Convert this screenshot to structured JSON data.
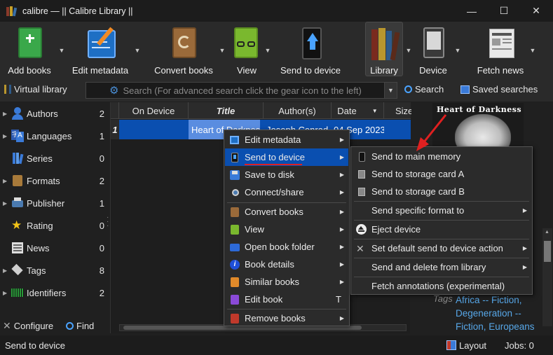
{
  "window": {
    "title": "calibre — || Calibre Library ||",
    "minimize": "—",
    "maximize": "☐",
    "close": "✕"
  },
  "toolbar": {
    "items": [
      {
        "label": "Add books",
        "icon": "add-books-icon"
      },
      {
        "label": "Edit metadata",
        "icon": "edit-metadata-icon"
      },
      {
        "label": "Convert books",
        "icon": "convert-books-icon"
      },
      {
        "label": "View",
        "icon": "view-icon"
      },
      {
        "label": "Send to device",
        "icon": "send-to-device-icon"
      },
      {
        "label": "Library",
        "icon": "library-icon"
      },
      {
        "label": "Device",
        "icon": "device-icon"
      },
      {
        "label": "Fetch news",
        "icon": "fetch-news-icon"
      }
    ]
  },
  "searchbar": {
    "virtual_library": "Virtual library",
    "placeholder": "Search (For advanced search click the gear icon to the left)",
    "search_label": "Search",
    "saved_searches_label": "Saved searches"
  },
  "tag_browser": {
    "items": [
      {
        "label": "Authors",
        "count": "2"
      },
      {
        "label": "Languages",
        "count": "1"
      },
      {
        "label": "Series",
        "count": "0"
      },
      {
        "label": "Formats",
        "count": "2"
      },
      {
        "label": "Publisher",
        "count": "1"
      },
      {
        "label": "Rating",
        "count": "0"
      },
      {
        "label": "News",
        "count": "0"
      },
      {
        "label": "Tags",
        "count": "8"
      },
      {
        "label": "Identifiers",
        "count": "2"
      }
    ],
    "configure_label": "Configure",
    "find_label": "Find"
  },
  "book_list": {
    "columns": [
      "On Device",
      "Title",
      "Author(s)",
      "Date",
      "Size"
    ],
    "rows": [
      {
        "num": "1",
        "on_device": "",
        "title": "Heart of Darkness",
        "authors": "Joseph Conrad",
        "date": "04 Sep 2023",
        "size": "0"
      }
    ]
  },
  "details": {
    "cover_title": "Heart of Darkness",
    "tags_label": "Tags",
    "tags_value": "Africa -- Fiction, Degeneration -- Fiction, Europeans"
  },
  "context_menu": {
    "items": [
      "Edit metadata",
      "Send to device",
      "Save to disk",
      "Connect/share",
      "Convert books",
      "View",
      "Open book folder",
      "Book details",
      "Similar books",
      "Edit book",
      "Remove books"
    ],
    "edit_book_shortcut": "T"
  },
  "send_submenu": {
    "items": [
      "Send to main memory",
      "Send to storage card A",
      "Send to storage card B",
      "Send specific format to",
      "Eject device",
      "Set default send to device action",
      "Send and delete from library",
      "Fetch annotations (experimental)"
    ]
  },
  "statusbar": {
    "message": "Send to device",
    "layout_label": "Layout",
    "jobs_label": "Jobs: 0"
  },
  "colors": {
    "highlight": "#0a4fb0",
    "link": "#57a7e8",
    "annotation": "#e02020"
  }
}
